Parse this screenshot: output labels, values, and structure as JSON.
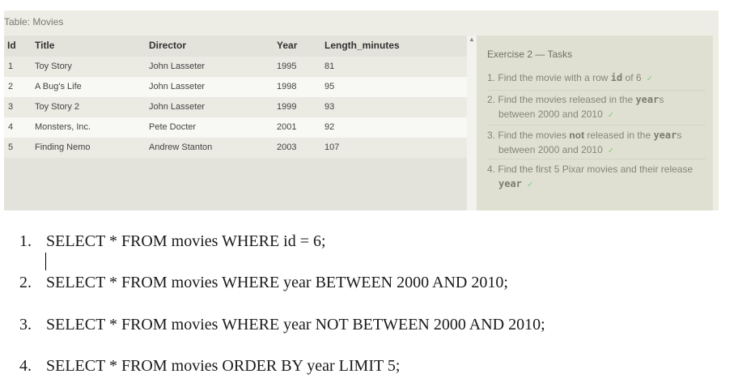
{
  "table": {
    "caption": "Table: Movies",
    "columns": [
      "Id",
      "Title",
      "Director",
      "Year",
      "Length_minutes"
    ],
    "rows": [
      [
        "1",
        "Toy Story",
        "John Lasseter",
        "1995",
        "81"
      ],
      [
        "2",
        "A Bug's Life",
        "John Lasseter",
        "1998",
        "95"
      ],
      [
        "3",
        "Toy Story 2",
        "John Lasseter",
        "1999",
        "93"
      ],
      [
        "4",
        "Monsters, Inc.",
        "Pete Docter",
        "2001",
        "92"
      ],
      [
        "5",
        "Finding Nemo",
        "Andrew Stanton",
        "2003",
        "107"
      ]
    ]
  },
  "scrollbar": {
    "up_arrow": "▲"
  },
  "tasks": {
    "title": "Exercise 2 — Tasks",
    "check": "✓",
    "items": [
      {
        "num": "1.",
        "pre": "Find the movie with a row ",
        "kw": "id",
        "post": " of 6"
      },
      {
        "num": "2.",
        "pre": "Find the movies released in the ",
        "kw": "year",
        "post": "s",
        "line2": "between 2000 and 2010"
      },
      {
        "num": "3.",
        "pre": "Find the movies ",
        "bold": "not",
        "mid": " released in the ",
        "kw": "year",
        "post": "s",
        "line2": "between 2000 and 2010"
      },
      {
        "num": "4.",
        "pre": "Find the first 5 Pixar movies and their release",
        "kw": "year"
      }
    ]
  },
  "answers": [
    {
      "num": "1.",
      "text": "SELECT * FROM movies WHERE id = 6;"
    },
    {
      "num": "2.",
      "text": "SELECT * FROM movies WHERE year BETWEEN 2000 AND 2010;"
    },
    {
      "num": "3.",
      "text": "SELECT * FROM movies WHERE year NOT BETWEEN 2000 AND 2010;"
    },
    {
      "num": "4.",
      "text": "SELECT * FROM movies ORDER BY year LIMIT 5;"
    }
  ]
}
